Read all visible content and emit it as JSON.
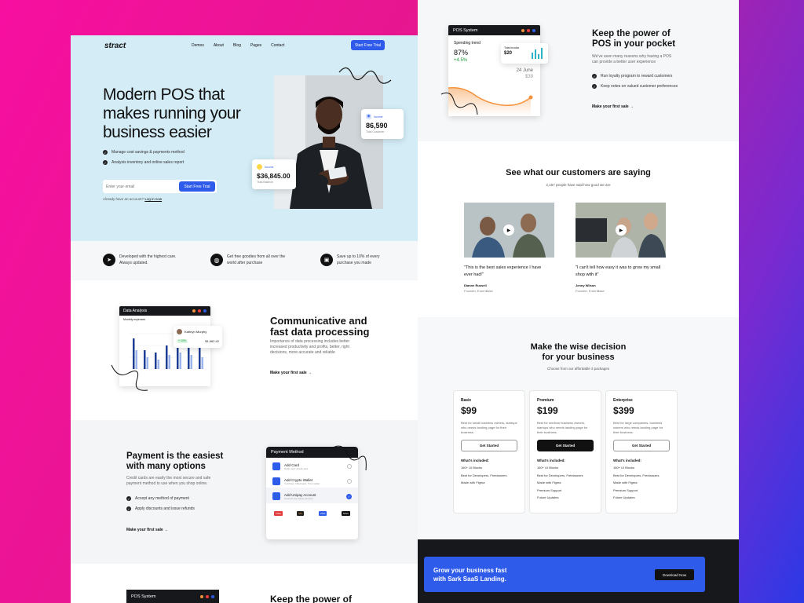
{
  "nav": {
    "logo": "stract",
    "links": [
      "Demos",
      "About",
      "Blog",
      "Pages",
      "Contact"
    ],
    "cta": "Start Free Trial"
  },
  "hero": {
    "title_lines": [
      "Modern POS that",
      "makes running your",
      "business easier"
    ],
    "checks": [
      "Manage cost savings & payments method",
      "Analysis inventory and online sales report"
    ],
    "email_placeholder": "Enter your email",
    "cta": "Start Free Trial",
    "login_prefix": "Already have an account?",
    "login_link": "Log in now",
    "stat1": {
      "label": "Income",
      "value": "86,590",
      "sub": "Total Customer"
    },
    "stat2": {
      "label": "Income",
      "value": "$36,845.00",
      "sub": "Total Balance"
    }
  },
  "benefits": [
    {
      "icon": "send-icon",
      "text": "Developed with the highest care. Always updated."
    },
    {
      "icon": "globe-icon",
      "text": "Get free goodies from all over the world after purchase"
    },
    {
      "icon": "wallet-icon",
      "text": "Save up to 10% of every purchase you made"
    }
  ],
  "data_analysis": {
    "card_title": "Data Analysis",
    "card_sub": "Monthly expenses",
    "person": "Kathryn Murphy",
    "badge": "+ 10%",
    "amount": "$1,962.42",
    "title_lines": [
      "Communicative and",
      "fast data processing"
    ],
    "desc": "Importance of data processing includes better increased productivity and profits, better, right decisions, more accurate and reliable",
    "cta": "Make your first sale"
  },
  "chart_data": {
    "type": "bar",
    "categories": [
      "1",
      "2",
      "3",
      "4",
      "5",
      "6",
      "7"
    ],
    "series": [
      {
        "values": [
          65,
          40,
          35,
          50,
          55,
          50,
          45
        ]
      },
      {
        "values": [
          40,
          25,
          20,
          30,
          35,
          30,
          25
        ]
      }
    ]
  },
  "payment": {
    "title_lines": [
      "Payment is the easiest",
      "with many options"
    ],
    "desc": "Credit cards are easily the most secure and safe payment method to use when you shop online.",
    "checks": [
      "Accept any method of payment",
      "Apply discounts and issue refunds"
    ],
    "cta": "Make your first sale",
    "card_title": "Payment Method",
    "methods": [
      {
        "name": "Add Card",
        "sub": "Debit card, Credit card"
      },
      {
        "name": "Add Crypto Wallet",
        "sub": "Coinbase, Metamask, Trust wallet"
      },
      {
        "name": "Add Unipay Account",
        "sub": "Connect via unipay account"
      }
    ],
    "brands": [
      "VISA",
      "MC",
      "VISA",
      "DISA"
    ]
  },
  "pos_bottom": {
    "card_title": "POS System",
    "title": "Keep the power of"
  },
  "pos_top": {
    "card_title": "POS System",
    "trend_label": "Spending trend",
    "trend_value": "87%",
    "trend_delta": "+4.5%",
    "invoice_label": "Total invoice",
    "invoice_value": "$20",
    "date": "24 June",
    "date_val": "$39",
    "title_lines": [
      "Keep the power of",
      "POS in your pocket"
    ],
    "desc": "We've seen many reasons why having a POS can provide a better user experience",
    "checks": [
      "Run loyalty program to reward customers",
      "Keep notes on valued customer preferences"
    ],
    "cta": "Make your first sale"
  },
  "testimonials": {
    "title": "See what our customers are saying",
    "sub": "2,157 people have said how good we are",
    "items": [
      {
        "quote": "\"This is the best sales experience I have ever had!\"",
        "name": "Dianne Russell",
        "role": "Founder, EnernBase"
      },
      {
        "quote": "\"I can't tell how easy it was to grow my small shop with it\"",
        "name": "Jenny Wilson",
        "role": "Founder, EnernBase"
      }
    ]
  },
  "pricing": {
    "title_lines": [
      "Make the wise decision",
      "for your business"
    ],
    "sub": "Choose from our affordable 3 packages",
    "included_label": "What's included:",
    "plans": [
      {
        "name": "Basic",
        "price": "$99",
        "desc": "Best for small business owners, startups who needs landing page for their business.",
        "cta": "Get Started",
        "features": [
          "160+ UI Blocks",
          "Best for Developers, Freelancers",
          "Made with Figma"
        ]
      },
      {
        "name": "Premium",
        "price": "$199",
        "desc": "Best for medium business owners, startups who needs landing page for their business.",
        "cta": "Get Started",
        "features": [
          "160+ UI Blocks",
          "Best for Developers, Freelancers",
          "Made with Figma",
          "Premium Support",
          "Future Updates"
        ]
      },
      {
        "name": "Enterprise",
        "price": "$399",
        "desc": "Best for large companies, business owners who needs landing page for their business.",
        "cta": "Get Started",
        "features": [
          "160+ UI Blocks",
          "Best for Developers, Freelancers",
          "Made with Figma",
          "Premium Support",
          "Future Updates"
        ]
      }
    ]
  },
  "footer_cta": {
    "title_lines": [
      "Grow your business fast",
      "with Sark SaaS Landing."
    ],
    "button": "Download Now"
  },
  "colors": {
    "accent": "#2f5bea",
    "hero_bg": "#d3ecf6",
    "dark": "#111111",
    "orange": "#f5913a"
  }
}
